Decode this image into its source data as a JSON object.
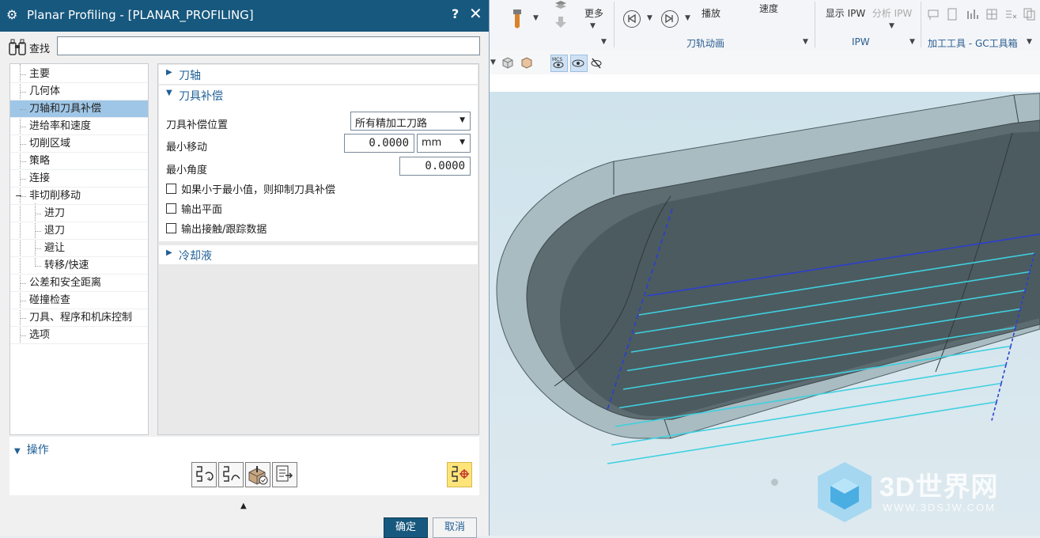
{
  "dialog": {
    "title": "Planar Profiling - [PLANAR_PROFILING]",
    "help": "?",
    "close": "✕",
    "find_label": "查找",
    "find_value": ""
  },
  "tree": {
    "items": [
      {
        "label": "主要"
      },
      {
        "label": "几何体"
      },
      {
        "label": "刀轴和刀具补偿"
      },
      {
        "label": "进给率和速度"
      },
      {
        "label": "切削区域"
      },
      {
        "label": "策略"
      },
      {
        "label": "连接"
      },
      {
        "label": "非切削移动"
      },
      {
        "label": "进刀"
      },
      {
        "label": "退刀"
      },
      {
        "label": "避让"
      },
      {
        "label": "转移/快速"
      },
      {
        "label": "公差和安全距离"
      },
      {
        "label": "碰撞检查"
      },
      {
        "label": "刀具、程序和机床控制"
      },
      {
        "label": "选项"
      }
    ],
    "selected": "刀轴和刀具补偿",
    "collapse_glyph": "−"
  },
  "panel": {
    "sec_axis": "刀轴",
    "sec_comp": "刀具补偿",
    "comp_position_label": "刀具补偿位置",
    "comp_position_value": "所有精加工刀路",
    "min_move_label": "最小移动",
    "min_move_value": "0.0000",
    "min_move_unit": "mm",
    "min_angle_label": "最小角度",
    "min_angle_value": "0.0000",
    "chk_suppress": "如果小于最小值，则抑制刀具补偿",
    "chk_plane": "输出平面",
    "chk_contact": "输出接触/跟踪数据",
    "sec_coolant": "冷却液"
  },
  "ops": {
    "title": "操作"
  },
  "buttons": {
    "ok": "确定",
    "cancel": "取消"
  },
  "ribbon": {
    "more": "更多",
    "play": "播放",
    "speed": "速度",
    "show_ipw": "显示 IPW",
    "analyze_ipw": "分析 IPW",
    "group_toolpath_anim": "刀轨动画",
    "group_ipw": "IPW",
    "group_tools": "加工工具 - GC工具箱"
  },
  "watermark": {
    "main": "3D世界网",
    "url": "WWW.3DSJW.COM"
  },
  "colors": {
    "titlebar": "#17587e",
    "selection": "#9fc6e6",
    "section_text": "#1f5f96",
    "toolpath_cut": "#3fd0e0",
    "toolpath_rapid": "#2b3fd0"
  }
}
